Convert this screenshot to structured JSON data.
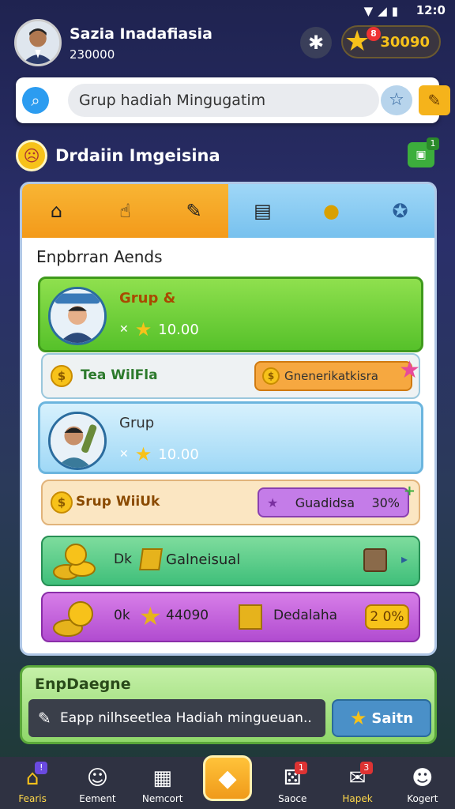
{
  "status": {
    "time": "12:0"
  },
  "profile": {
    "name": "Sazia Inadafiasia",
    "coins": "230000",
    "stars": "30090",
    "star_badge": "8"
  },
  "search": {
    "placeholder": "Grup  hadiah Mingugatim"
  },
  "section": {
    "title": "Drdaiin Imgeisina",
    "gift_count": "1"
  },
  "panel": {
    "tabs": [
      "home-icon",
      "hand-icon",
      "notes-icon",
      "jar-icon",
      "coin-icon",
      "star-icon"
    ],
    "heading": "Enpbrran Aends",
    "rows": {
      "r1": {
        "title": "Grup &",
        "value": "10.00"
      },
      "r2": {
        "label": "Tea WilFla",
        "button": "Gnenerikatkisra"
      },
      "r3": {
        "title": "Grup",
        "value": "10.00"
      },
      "r4": {
        "label": "Srup WiiUk",
        "button": "Guadidsa",
        "percent": "30%"
      },
      "r5": {
        "ok": "Dk",
        "label": "Galneisual"
      },
      "r6": {
        "ok": "0k",
        "num": "44090",
        "label": "Dedalaha",
        "percent": "2 0%"
      }
    }
  },
  "compose": {
    "title": "EnpDaegne",
    "input": "Eapp nilhseetleа Hadiah minguеuan..",
    "send": "Saitn"
  },
  "nav": [
    {
      "label": "Fearis",
      "icon": "home-icon",
      "badge": "!"
    },
    {
      "label": "Eement",
      "icon": "smile-icon",
      "badge": ""
    },
    {
      "label": "Nemcort",
      "icon": "grid-icon",
      "badge": ""
    },
    {
      "label": "",
      "icon": "center-icon",
      "badge": ""
    },
    {
      "label": "Saoce",
      "icon": "dice-icon",
      "badge": "1"
    },
    {
      "label": "Hapek",
      "icon": "gift-icon",
      "badge": "3"
    },
    {
      "label": "Kogert",
      "icon": "user-icon",
      "badge": ""
    }
  ],
  "colors": {
    "orange_tab": "#f8b534",
    "blue_tab": "#9fd7f7",
    "accent_star": "#f7c21a",
    "nav_bg": "#2f3242"
  }
}
